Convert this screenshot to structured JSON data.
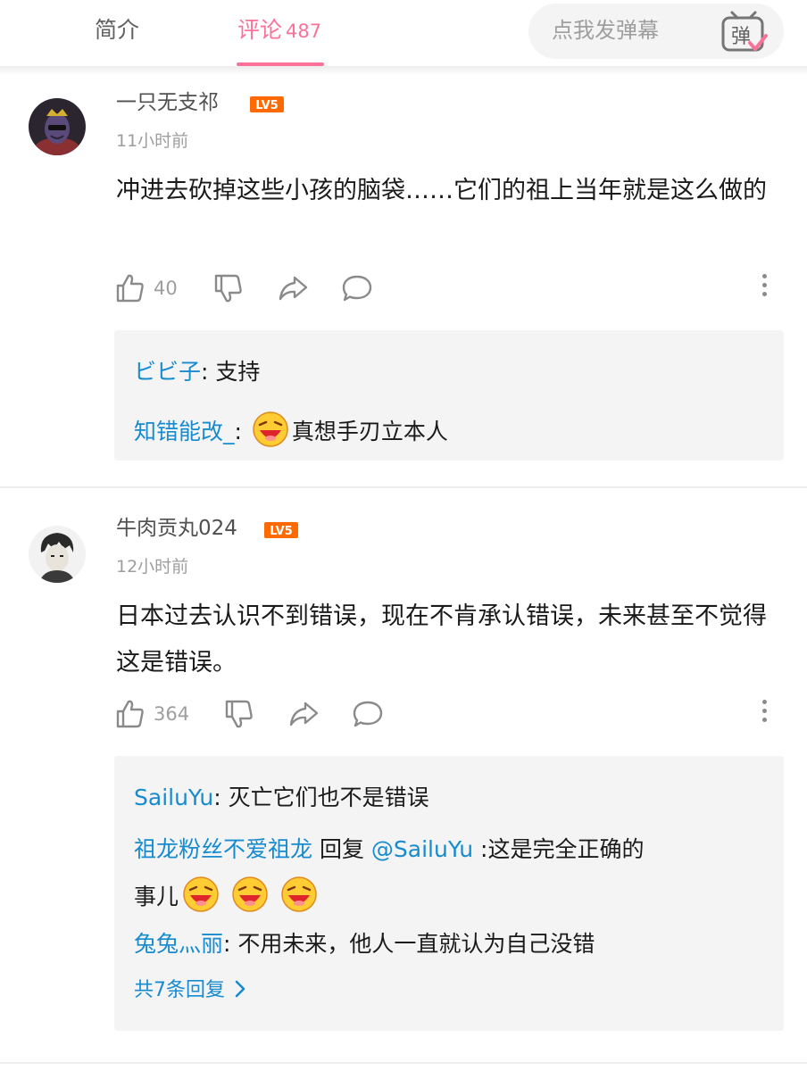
{
  "tabs": {
    "intro": "简介",
    "comments": "评论",
    "comments_count": "487",
    "danmaku_placeholder": "点我发弹幕",
    "danmaku_icon_char": "弹"
  },
  "colors": {
    "accent": "#fb7299",
    "link": "#178bcf",
    "level_badge": "#ff6a00"
  },
  "comments": [
    {
      "username": "一只无支祁",
      "level": "LV5",
      "time": "11小时前",
      "text": "冲进去砍掉这些小孩的脑袋……它们的祖上当年就是这么做的",
      "likes": "40",
      "replies": [
        {
          "name": "ビビ子",
          "sep": ": ",
          "text": "支持"
        },
        {
          "name": "知错能改_",
          "sep": ": ",
          "emoji": "laughing-face",
          "text": "真想手刃立本人"
        }
      ]
    },
    {
      "username": "牛肉贡丸024",
      "level": "LV5",
      "time": "12小时前",
      "text": "日本过去认识不到错误，现在不肯承认错误，未来甚至不觉得这是错误。",
      "likes": "364",
      "replies": [
        {
          "name": "SailuYu",
          "sep": ": ",
          "text": "灭亡它们也不是错误"
        },
        {
          "name": "祖龙粉丝不爱祖龙",
          "mid": " 回复 ",
          "mention": "@SailuYu",
          "text": " :这是完全正确的",
          "text2": "事儿"
        },
        {
          "name": "兔兔灬丽",
          "sep": ": ",
          "text": "不用未来，他人一直就认为自己没错"
        }
      ],
      "reply_total": "共7条回复"
    }
  ]
}
